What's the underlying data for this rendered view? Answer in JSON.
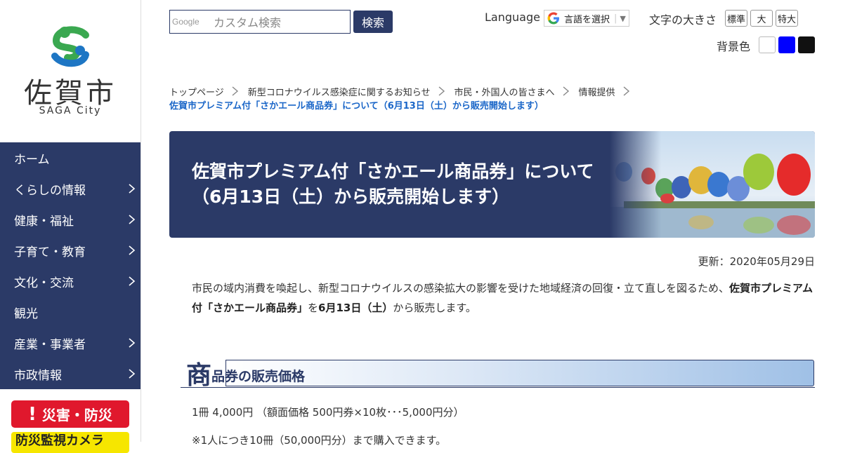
{
  "logo": {
    "name": "佐賀市",
    "sub": "SAGA City"
  },
  "nav": {
    "items": [
      {
        "label": "ホーム",
        "has_sub": false
      },
      {
        "label": "くらしの情報",
        "has_sub": true
      },
      {
        "label": "健康・福祉",
        "has_sub": true
      },
      {
        "label": "子育て・教育",
        "has_sub": true
      },
      {
        "label": "文化・交流",
        "has_sub": true
      },
      {
        "label": "観光",
        "has_sub": false
      },
      {
        "label": "産業・事業者",
        "has_sub": true
      },
      {
        "label": "市政情報",
        "has_sub": true
      }
    ]
  },
  "side_buttons": {
    "disaster": "災害・防災",
    "camera": "防災監視カメラ"
  },
  "search": {
    "brand": "Google",
    "placeholder": "カスタム検索",
    "button": "検索"
  },
  "language": {
    "label": "Language",
    "select": "言語を選択"
  },
  "font_size": {
    "label": "文字の大きさ",
    "options": [
      "標準",
      "大",
      "特大"
    ]
  },
  "background": {
    "label": "背景色",
    "colors": [
      "#ffffff",
      "#0000ff",
      "#111111"
    ]
  },
  "breadcrumb": {
    "items": [
      "トップページ",
      "新型コロナウイルス感染症に関するお知らせ",
      "市民・外国人の皆さまへ",
      "情報提供"
    ],
    "current": "佐賀市プレミアム付「さかエール商品券」について（6月13日（土）から販売開始します）"
  },
  "hero": {
    "title": "佐賀市プレミアム付「さかエール商品券」について（6月13日（土）から販売開始します）"
  },
  "updated": "更新：2020年05月29日",
  "intro": {
    "text1": "市民の域内消費を喚起し、新型コロナウイルスの感染拡大の影響を受けた地域経済の回復・立て直しを図るため、",
    "bold1": "佐賀市プレミアム付「さかエール商品券」",
    "text2": "を",
    "bold2": "6月13日（土）",
    "text3": "から販売します。"
  },
  "section": {
    "big_char": "商",
    "rest": "品券の販売価格"
  },
  "price_line": "1冊 4,000円 （額面価格 500円券×10枚･･･5,000円分）",
  "note_line": "※1人につき10冊（50,000円分）まで購入できます。",
  "colors": {
    "navy": "#2b3a67",
    "red": "#e0182d",
    "yellow": "#f6e600",
    "link": "#1a66c8"
  }
}
